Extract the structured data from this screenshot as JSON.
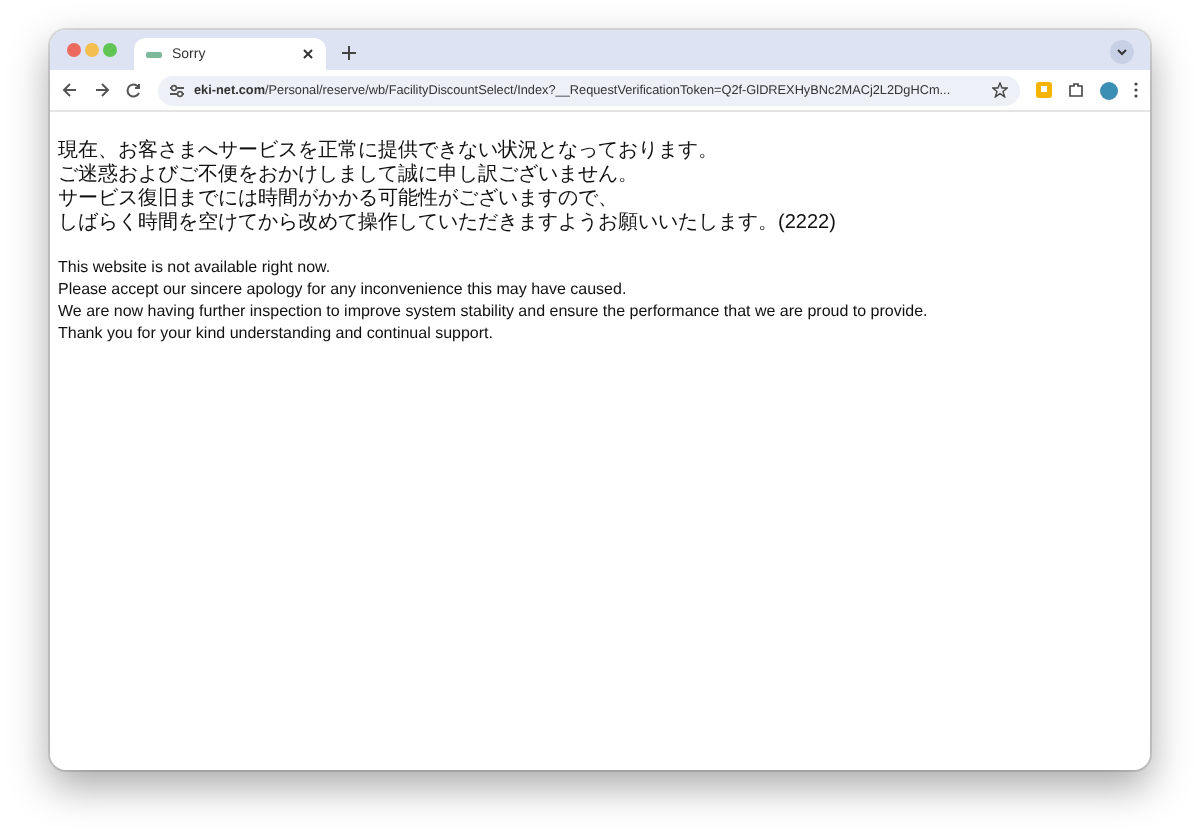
{
  "tab": {
    "title": "Sorry",
    "selected": true
  },
  "address": {
    "domain": "eki-net.com",
    "path": "/Personal/reserve/wb/FacilityDiscountSelect/Index?__RequestVerificationToken=Q2f-GlDREXHyBNc2MACj2L2DgHCm..."
  },
  "japanese_message": [
    "現在、お客さまへサービスを正常に提供できない状況となっております。",
    "ご迷惑およびご不便をおかけしまして誠に申し訳ございません。",
    "サービス復旧までには時間がかかる可能性がございますので、",
    "しばらく時間を空けてから改めて操作していただきますようお願いいたします。(2222)"
  ],
  "english_message": [
    "This website is not available right now.",
    "Please accept our sincere apology for any inconvenience this may have caused.",
    "We are now having further inspection to improve system stability and ensure the performance that we are proud to provide.",
    "Thank you for your kind understanding and continual support."
  ]
}
